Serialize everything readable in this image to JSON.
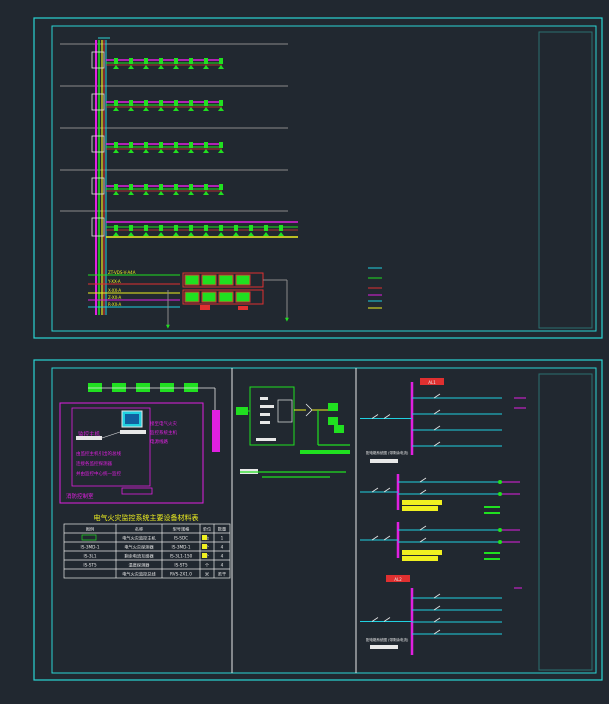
{
  "colors": {
    "background": "#212830",
    "frame": "#2ad4d4",
    "magenta": "#e020e0",
    "green": "#20e020",
    "yellow": "#f0f020",
    "red": "#e03030",
    "white": "#e8e8e8",
    "cyan_line": "#20d0e0",
    "gray": "#8a8a8a"
  },
  "sheet1": {
    "legend_labels": [
      "ZT-VDS-V-A4A",
      "Y-XX-A",
      "X-XX-A",
      "Z-XX-A",
      "R-XX-A"
    ]
  },
  "sheet2": {
    "monitor_box_label": "监控主机",
    "monitor_notes": [
      "接至电气火灾",
      "监控系统主机",
      "电源线路"
    ],
    "description_lines": [
      "由监控主机引出的总线",
      "连接各监控探测器",
      "并由监控中心统一监控"
    ],
    "panel_label": "消防控制室",
    "table": {
      "title": "电气火灾监控系统主要设备材料表",
      "headers": [
        "图例",
        "名称",
        "型号规格",
        "单位",
        "数量"
      ],
      "rows": [
        [
          "",
          "电气火灾监控主机",
          "IS-SDC",
          "台",
          "1"
        ],
        [
          "IS-3MD-1",
          "电气火灾探测器",
          "IS-3MD-1",
          "个",
          "4"
        ],
        [
          "IS-3L1",
          "剩余电流互感器",
          "IS-3L1-150",
          "个",
          "4"
        ],
        [
          "IS-ST5",
          "温度探测器",
          "IS-ST5",
          "个",
          "4"
        ],
        [
          "",
          "电气火灾监控总线",
          "RVS-2X1.0",
          "米",
          "若干"
        ]
      ]
    },
    "switchboards": {
      "top_label": "AL1",
      "bottom_label": "AL2",
      "caption_top": "配电箱系统图 (带剩余电流)",
      "caption_bottom": "配电箱系统图 (带剩余电流)",
      "branch_labels": [
        "WL1",
        "WL2",
        "WL3",
        "WL4",
        "WL5"
      ]
    }
  }
}
